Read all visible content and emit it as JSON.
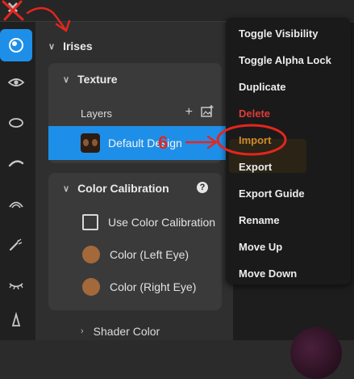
{
  "app": {
    "close_icon": "close-icon"
  },
  "sidebar": {
    "tools": [
      {
        "icon": "iris-icon",
        "active": true
      },
      {
        "icon": "eye-icon",
        "active": false
      },
      {
        "icon": "sclera-oval-icon",
        "active": false
      },
      {
        "icon": "eyebrow-icon",
        "active": false
      },
      {
        "icon": "eyelid-arc-icon",
        "active": false
      },
      {
        "icon": "eyelash-brush-icon",
        "active": false
      },
      {
        "icon": "lashes-icon",
        "active": false
      },
      {
        "icon": "nose-icon",
        "active": false
      }
    ]
  },
  "panel": {
    "section_title": "Irises",
    "texture": {
      "title": "Texture",
      "layers_label": "Layers",
      "add_icon": "plus-icon",
      "add_image_icon": "add-image-icon",
      "layer": {
        "name": "Default Design",
        "thumbnail_icon": "iris-thumbnail"
      }
    },
    "calibration": {
      "title": "Color Calibration",
      "help_icon": "question-icon",
      "use_label": "Use Color Calibration",
      "left_eye_label": "Color (Left Eye)",
      "right_eye_label": "Color (Right Eye)",
      "left_color": "#a3693a",
      "right_color": "#a3693a"
    },
    "shader_label": "Shader Color"
  },
  "context_menu": {
    "items": [
      "Toggle Visibility",
      "Toggle Alpha Lock",
      "Duplicate",
      "Delete",
      "Import",
      "Export",
      "Export Guide",
      "Rename",
      "Move Up",
      "Move Down"
    ],
    "danger_item": "Delete",
    "highlighted_item": "Import"
  },
  "annotation": {
    "label": "6",
    "color": "#e3261e"
  },
  "colors": {
    "accent": "#1e8fe8",
    "danger": "#e23a3a",
    "import_text": "#d08a2a"
  }
}
